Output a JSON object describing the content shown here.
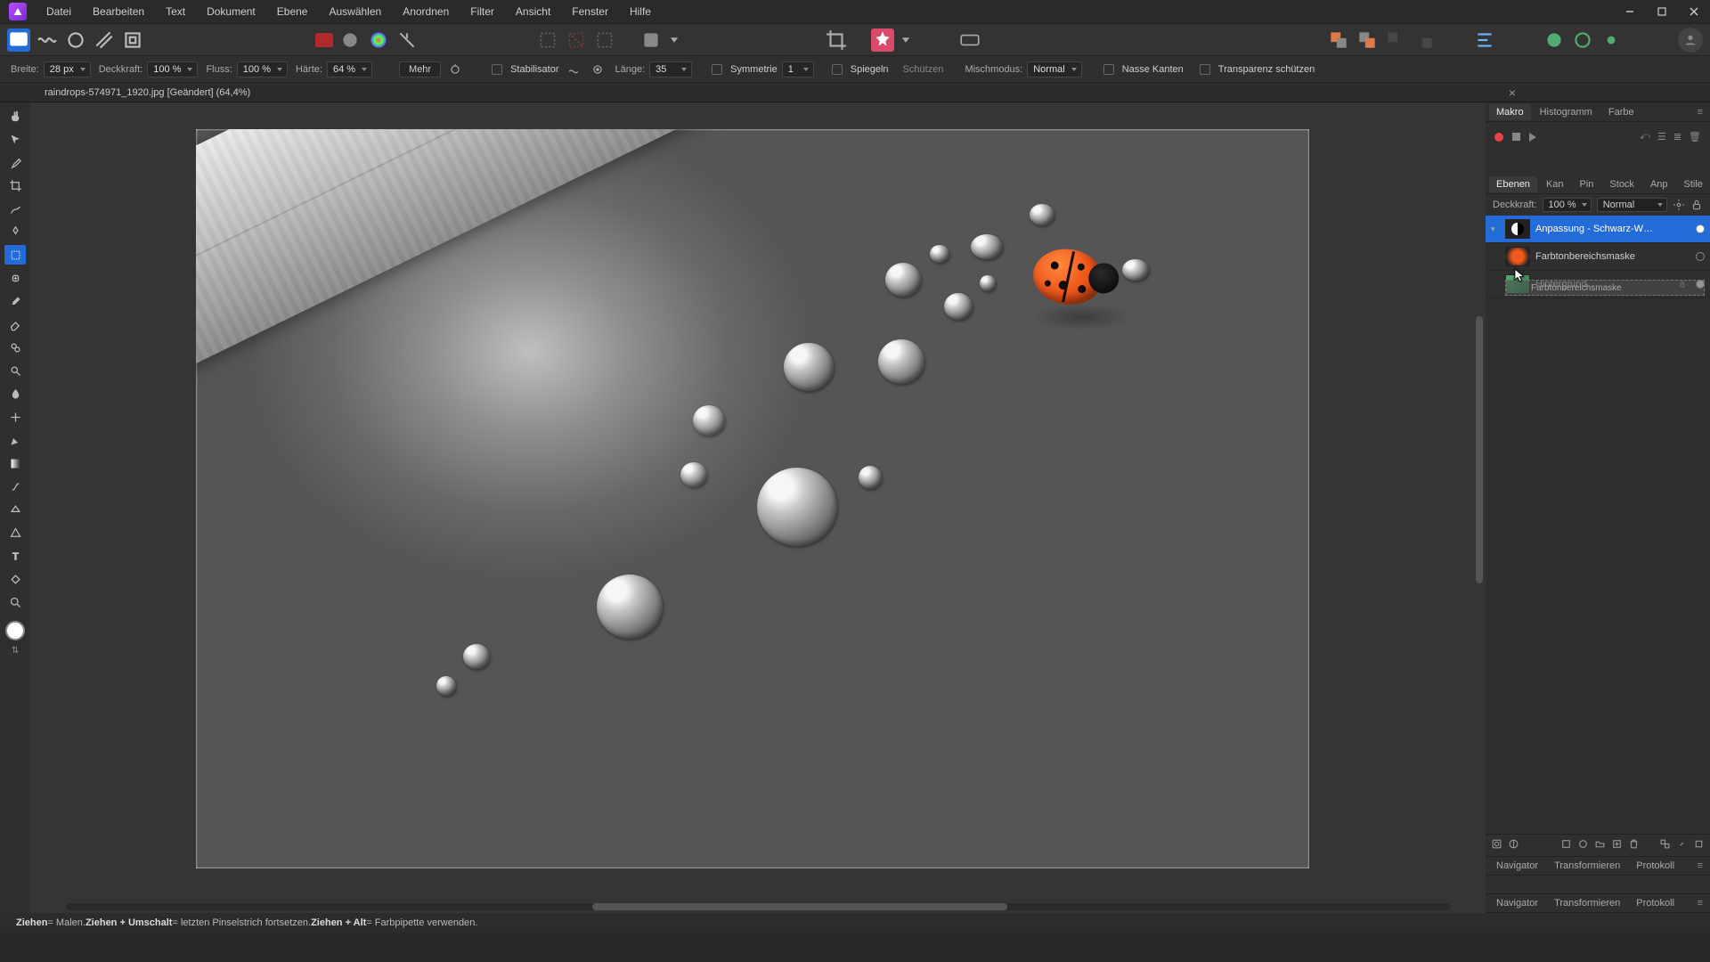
{
  "menu": {
    "items": [
      "Datei",
      "Bearbeiten",
      "Text",
      "Dokument",
      "Ebene",
      "Auswählen",
      "Anordnen",
      "Filter",
      "Ansicht",
      "Fenster",
      "Hilfe"
    ]
  },
  "doc_tab": "raindrops-574971_1920.jpg [Geändert] (64,4%)",
  "context": {
    "width_label": "Breite:",
    "width": "28 px",
    "opacity_label": "Deckkraft:",
    "opacity": "100 %",
    "flow_label": "Fluss:",
    "flow": "100 %",
    "hardness_label": "Härte:",
    "hardness": "64 %",
    "more": "Mehr",
    "stabilizer": "Stabilisator",
    "length_label": "Länge:",
    "length": "35",
    "symmetry": "Symmetrie",
    "sym_val": "1",
    "mirror": "Spiegeln",
    "protect": "Schützen",
    "blend_label": "Mischmodus:",
    "blend": "Normal",
    "wet": "Nasse Kanten",
    "trans": "Transparenz schützen"
  },
  "macro_tabs": [
    "Makro",
    "Histogramm",
    "Farbe"
  ],
  "layer_tabs": [
    "Ebenen",
    "Kan",
    "Pin",
    "Stock",
    "Anp",
    "Stile"
  ],
  "layer_head": {
    "opacity_label": "Deckkraft:",
    "opacity": "100 %",
    "blend": "Normal"
  },
  "layers": {
    "adjustment": "Anpassung - Schwarz-W…",
    "mask": "Farbtonbereichsmaske",
    "ghost": "Farbtonbereichsmaske",
    "background": "Hintergrund"
  },
  "bottom_tabs": [
    "Navigator",
    "Transformieren",
    "Protokoll"
  ],
  "status": {
    "drag": "Ziehen",
    "drag_desc": " = Malen. ",
    "shift": "Ziehen + Umschalt",
    "shift_desc": " = letzten Pinselstrich fortsetzen. ",
    "alt": "Ziehen + Alt",
    "alt_desc": " = Farbpipette verwenden."
  }
}
